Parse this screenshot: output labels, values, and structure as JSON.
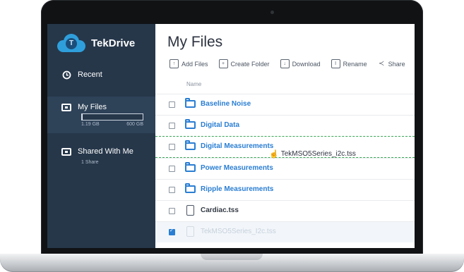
{
  "brand": {
    "name": "TekDrive"
  },
  "sidebar": {
    "recent_label": "Recent",
    "myfiles_label": "My Files",
    "usage_used": "1.19 GB",
    "usage_total": "600 GB",
    "usage_fraction": 0.01,
    "shared_label": "Shared With Me",
    "shared_note": "1 Share"
  },
  "main": {
    "title": "My Files",
    "toolbar": {
      "add_files": "Add Files",
      "create_folder": "Create Folder",
      "download": "Download",
      "rename": "Rename",
      "share": "Share"
    },
    "column_name": "Name",
    "rows": [
      {
        "name": "Baseline Noise",
        "type": "folder",
        "checked": false
      },
      {
        "name": "Digital Data",
        "type": "folder",
        "checked": false
      },
      {
        "name": "Digital Measurements",
        "type": "folder",
        "checked": false
      },
      {
        "name": "Power Measurements",
        "type": "folder",
        "checked": false
      },
      {
        "name": "Ripple Measurements",
        "type": "folder",
        "checked": false
      },
      {
        "name": "Cardiac.tss",
        "type": "file",
        "checked": false
      },
      {
        "name": "TekMSO5Series_I2c.tss",
        "type": "file",
        "checked": true
      }
    ],
    "drag_file": "TekMSO5Series_i2c.tss"
  },
  "colors": {
    "sidebar": "#26374a",
    "accent": "#2a7ed3",
    "drop_indicator": "#3aa655"
  },
  "icons": [
    "clock-icon",
    "folder-icon",
    "shared-folder-icon",
    "upload-icon",
    "create-folder-icon",
    "download-icon",
    "rename-icon",
    "share-icon",
    "file-icon",
    "checkbox-icon"
  ]
}
